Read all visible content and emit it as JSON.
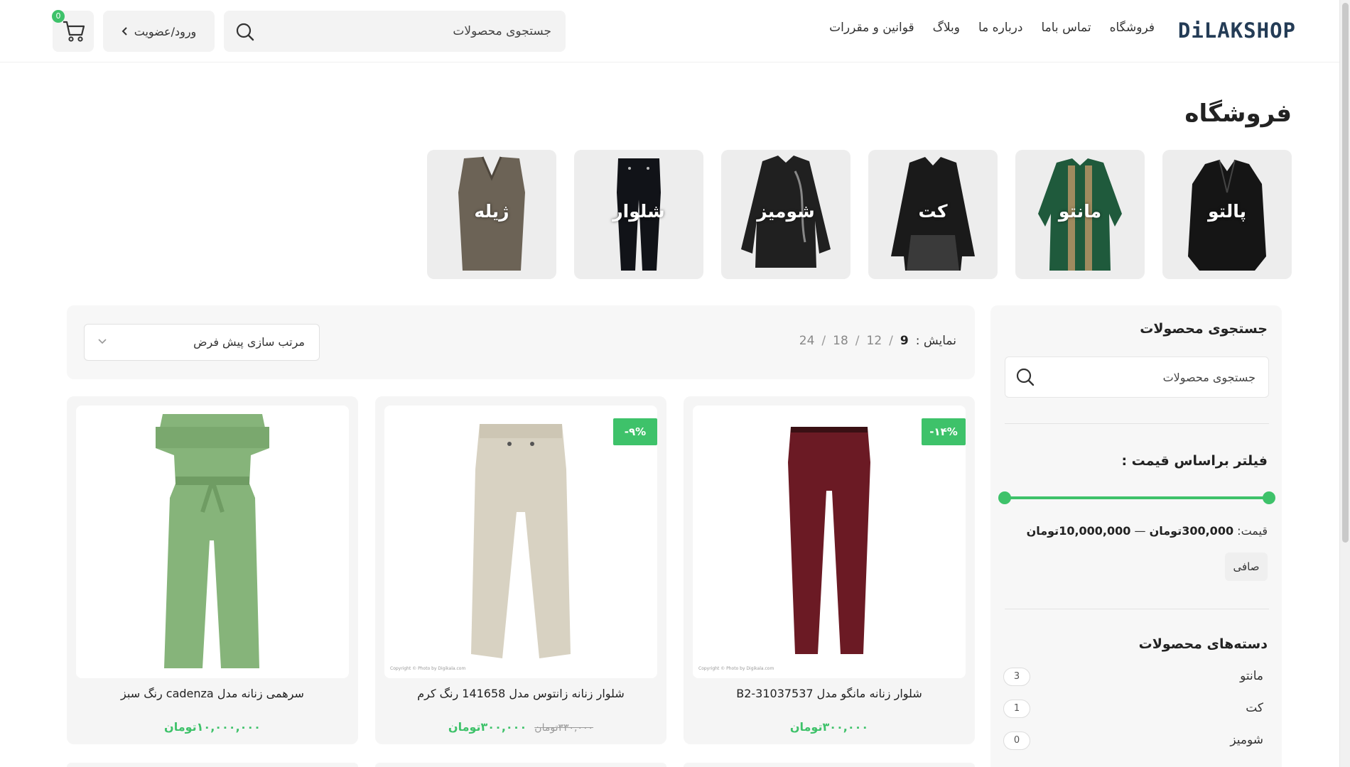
{
  "header": {
    "logo": "DiLAKSHOP",
    "nav": [
      "فروشگاه",
      "تماس باما",
      "درباره ما",
      "وبلاگ",
      "قوانین و مقررات"
    ],
    "search_placeholder": "جستجوی محصولات",
    "login_label": "ورود/عضویت",
    "cart_count": "0"
  },
  "page": {
    "title": "فروشگاه"
  },
  "categories": [
    {
      "label": "پالتو",
      "icon": "coat-image",
      "color": "#151515"
    },
    {
      "label": "مانتو",
      "icon": "manteau-image",
      "color": "#1f5a3c"
    },
    {
      "label": "کت",
      "icon": "jacket-image",
      "color": "#1a1a1a"
    },
    {
      "label": "شومیز",
      "icon": "blouse-image",
      "color": "#202020"
    },
    {
      "label": "شلوار",
      "icon": "pants-image",
      "color": "#111318"
    },
    {
      "label": "ژیله",
      "icon": "vest-image",
      "color": "#6c6356"
    }
  ],
  "sidebar": {
    "search_title": "جستجوی محصولات",
    "search_placeholder": "جستجوی محصولات",
    "price_filter_title": "فیلتر براساس قیمت :",
    "price_label": "قیمت:",
    "price_min": "300,000تومان",
    "price_sep": "—",
    "price_max": "10,000,000تومان",
    "slider_min_fraction": 0,
    "slider_max_fraction": 1,
    "clear_label": "صافی",
    "categories_title": "دسته‌های محصولات",
    "category_list": [
      {
        "name": "مانتو",
        "count": "3"
      },
      {
        "name": "کت",
        "count": "1"
      },
      {
        "name": "شومیز",
        "count": "0"
      }
    ]
  },
  "toolbar": {
    "show_label": "نمایش :",
    "per_page_options": [
      "9",
      "12",
      "18",
      "24"
    ],
    "per_page_active": "9",
    "sort_label": "مرتب سازی پیش فرض"
  },
  "products": [
    {
      "title": "سرهمی زنانه مدل cadenza رنگ سبز",
      "price": "۱۰,۰۰۰,۰۰۰تومان",
      "old_price": "",
      "badge": "",
      "image": "green-jumpsuit",
      "color": "#86b47a",
      "copyright": ""
    },
    {
      "title": "شلوار زنانه زانتوس مدل 141658 رنگ کرم",
      "price": "۳۰۰,۰۰۰تومان",
      "old_price": "۳۳۰,۰۰۰تومان",
      "badge": "-۹%",
      "image": "cream-trousers",
      "color": "#d8d2c2",
      "copyright": "Copyright © Photo by Digikala.com"
    },
    {
      "title": "شلوار زنانه مانگو مدل B2-31037537",
      "price": "۳۰۰,۰۰۰تومان",
      "old_price": "",
      "badge": "-۱۴%",
      "image": "burgundy-trousers",
      "color": "#6b1a24",
      "copyright": "Copyright © Photo by Digikala.com"
    }
  ],
  "colors": {
    "accent": "#3ec26a",
    "logo": "#243c56"
  }
}
